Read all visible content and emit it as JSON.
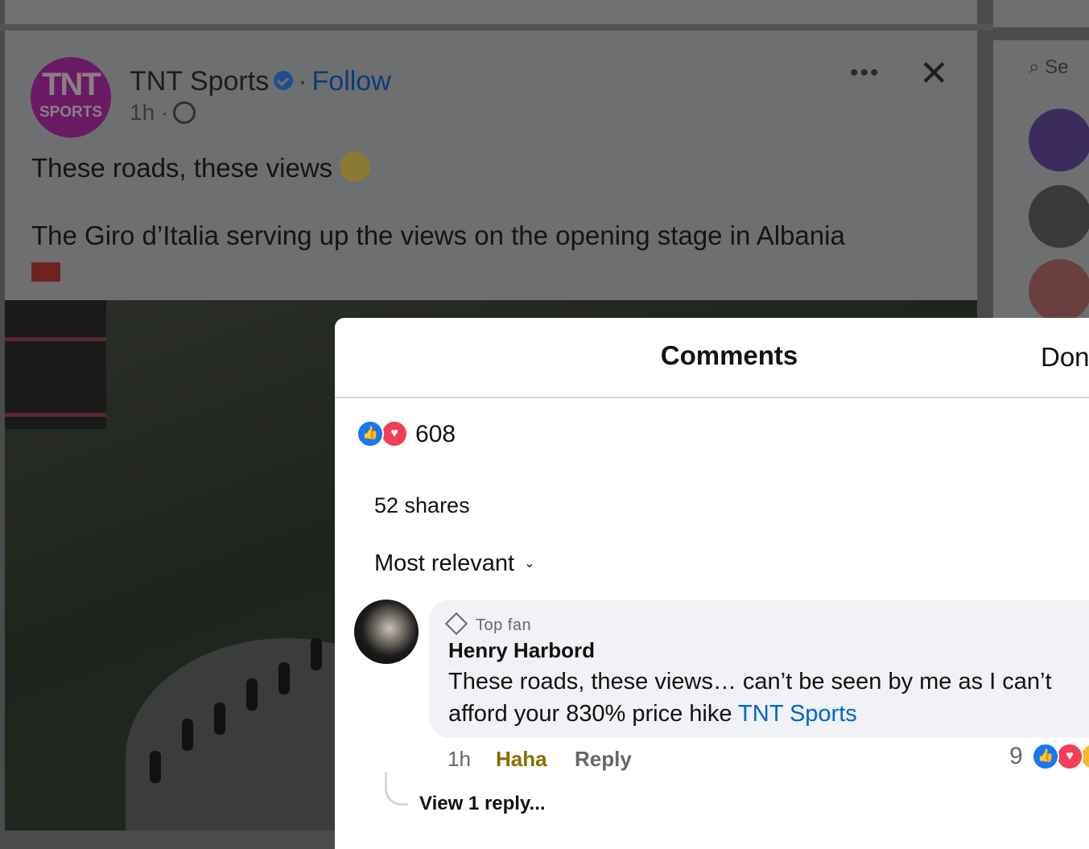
{
  "post": {
    "page_name": "TNT Sports",
    "avatar_text_top": "TNT",
    "avatar_text_bottom": "SPORTS",
    "separator": "·",
    "follow_label": "Follow",
    "time": "1h",
    "time_separator": "·",
    "line1": "These roads, these views",
    "line2": "The Giro d’Italia serving up the views on the opening stage in Albania",
    "more_label": "•••",
    "close_label": "✕"
  },
  "right_col": {
    "search_ghost": "Se"
  },
  "sheet": {
    "title": "Comments",
    "done_label": "Done",
    "reaction_count": "608",
    "shares": "52 shares",
    "sort_label": "Most relevant",
    "sort_chevron": "⌄"
  },
  "comment": {
    "badge": "Top fan",
    "author": "Henry Harbord",
    "text": "These roads, these views… can’t be seen by me as I can’t afford your 830% price hike ",
    "mention": "TNT Sports",
    "time": "1h",
    "haha_label": "Haha",
    "reply_label": "Reply",
    "reaction_count": "9",
    "view_replies": "View 1 reply..."
  },
  "colors": {
    "like_blue": "#1877f2",
    "love_red": "#f33e58",
    "mention_blue": "#0064d1",
    "follow_blue": "#0e3a78",
    "haha_gold": "#8a6d00"
  }
}
